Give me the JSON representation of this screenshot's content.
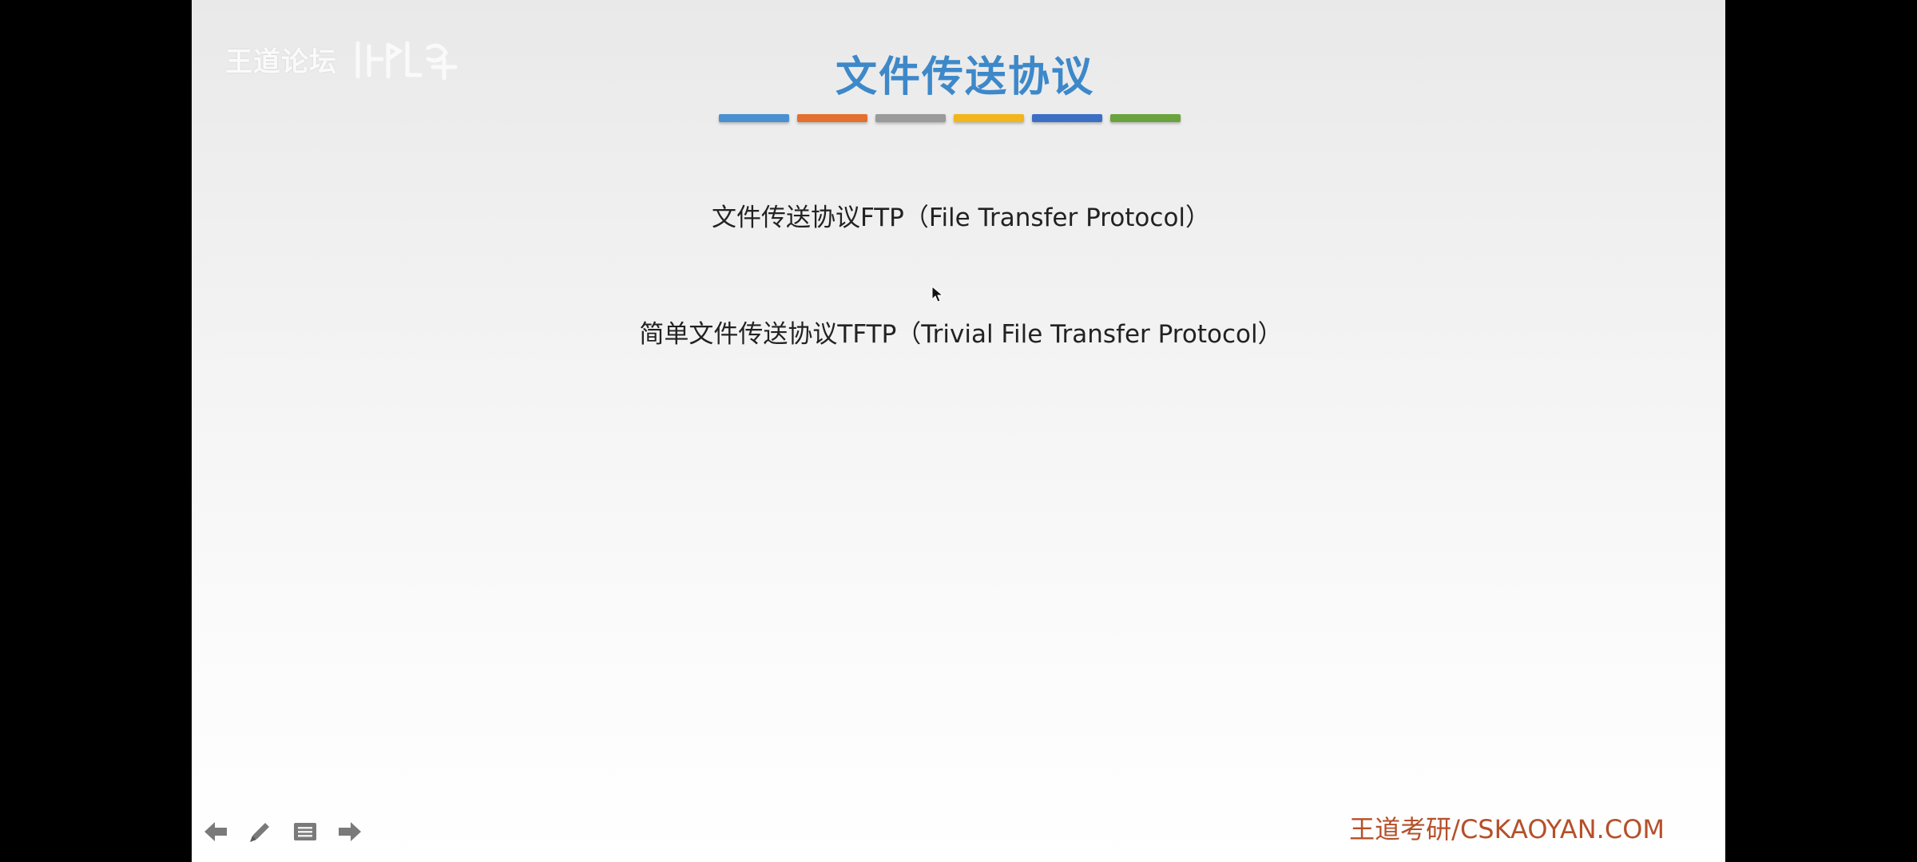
{
  "slide": {
    "watermark_text": "王道论坛",
    "title": "文件传送协议",
    "accent_color": "#3d88c9",
    "color_bars": [
      "#4a90d0",
      "#e3702f",
      "#9a9a9a",
      "#f2b51a",
      "#3a6fc4",
      "#6aa33d"
    ],
    "lines": [
      "文件传送协议FTP（File Transfer Protocol）",
      "简单文件传送协议TFTP（Trivial File Transfer Protocol）"
    ],
    "footer_brand": "王道考研/CSKAOYAN.COM"
  },
  "toolbar": {
    "icons": [
      "arrow-left-icon",
      "pen-icon",
      "menu-icon",
      "arrow-right-icon"
    ]
  }
}
